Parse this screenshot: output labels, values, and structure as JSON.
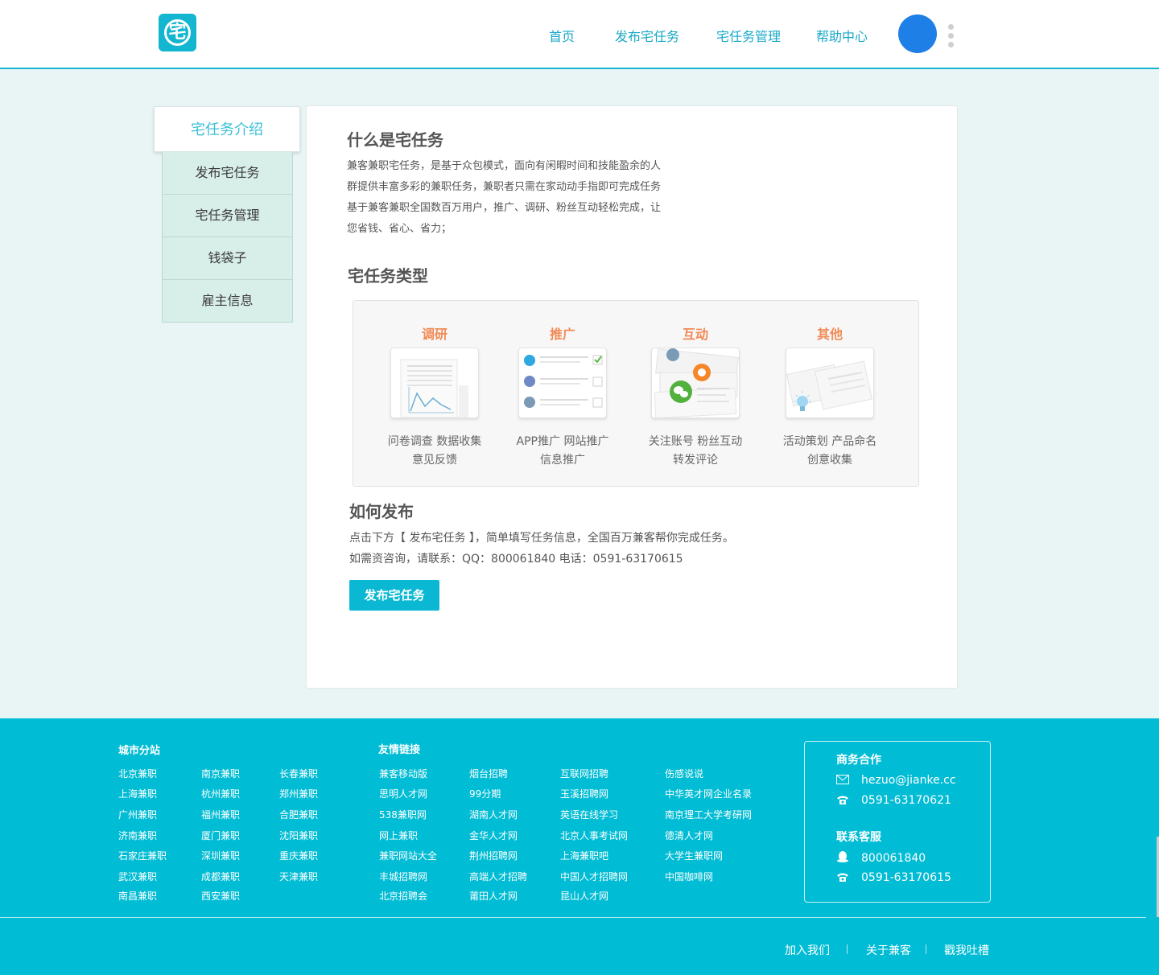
{
  "header": {
    "logo_glyph": "宅",
    "nav": [
      "首页",
      "发布宅任务",
      "宅任务管理",
      "帮助中心"
    ]
  },
  "sidebar": {
    "active": "宅任务介绍",
    "items": [
      "发布宅任务",
      "宅任务管理",
      "钱袋子",
      "雇主信息"
    ]
  },
  "main": {
    "what_title": "什么是宅任务",
    "what_lines": [
      "兼客兼职宅任务，是基于众包模式，面向有闲暇时间和技能盈余的人",
      "群提供丰富多彩的兼职任务，兼职者只需在家动动手指即可完成任务",
      "基于兼客兼职全国数百万用户，推广、调研、粉丝互动轻松完成，让",
      "您省钱、省心、省力；"
    ],
    "types_title": "宅任务类型",
    "types": [
      {
        "title": "调研",
        "line1": "问卷调查  数据收集",
        "line2": "意见反馈"
      },
      {
        "title": "推广",
        "line1": "APP推广  网站推广",
        "line2": "信息推广"
      },
      {
        "title": "互动",
        "line1": "关注账号  粉丝互动",
        "line2": "转发评论"
      },
      {
        "title": "其他",
        "line1": "活动策划  产品命名",
        "line2": "创意收集"
      }
    ],
    "how_title": "如何发布",
    "how_lines": [
      "点击下方【 发布宅任务 】，简单填写任务信息，全国百万兼客帮你完成任务。",
      "如需资咨询，请联系：QQ：800061840   电话：0591-63170615"
    ],
    "publish_button": "发布宅任务"
  },
  "footer": {
    "city_title": "城市分站",
    "cities": [
      [
        "北京兼职",
        "南京兼职",
        "长春兼职"
      ],
      [
        "上海兼职",
        "杭州兼职",
        "郑州兼职"
      ],
      [
        "广州兼职",
        "福州兼职",
        "合肥兼职"
      ],
      [
        "济南兼职",
        "厦门兼职",
        "沈阳兼职"
      ],
      [
        "石家庄兼职",
        "深圳兼职",
        "重庆兼职"
      ],
      [
        "武汉兼职",
        "成都兼职",
        "天津兼职"
      ],
      [
        "南昌兼职",
        "西安兼职",
        ""
      ]
    ],
    "friend_title": "友情链接",
    "friends": [
      [
        "兼客移动版",
        "烟台招聘",
        "互联网招聘",
        "伤感说说"
      ],
      [
        "思明人才网",
        "99分期",
        "玉溪招聘网",
        "中华英才网企业名录"
      ],
      [
        "538兼职网",
        "湖南人才网",
        "英语在线学习",
        "南京理工大学考研网"
      ],
      [
        "网上兼职",
        "金华人才网",
        "北京人事考试网",
        "德清人才网"
      ],
      [
        "兼职网站大全",
        "荆州招聘网",
        "上海兼职吧",
        "大学生兼职网"
      ],
      [
        "丰城招聘网",
        "高端人才招聘",
        "中国人才招聘网",
        "中国咖啡网"
      ],
      [
        "北京招聘会",
        "莆田人才网",
        "昆山人才网",
        ""
      ]
    ],
    "business_title": "商务合作",
    "business_email": "hezuo@jianke.cc",
    "business_phone": "0591-63170621",
    "service_title": "联系客服",
    "service_qq": "800061840",
    "service_phone": "0591-63170615",
    "bottom_links": [
      "加入我们",
      "关于兼客",
      "戳我吐槽"
    ]
  },
  "colors": {
    "accent": "#00bcd4",
    "orange": "#f28a55",
    "avatar": "#1e7fe6"
  }
}
